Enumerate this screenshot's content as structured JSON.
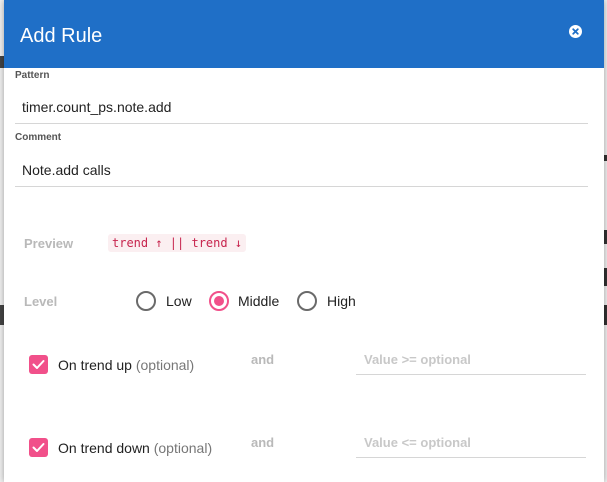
{
  "dialog": {
    "title": "Add Rule"
  },
  "pattern": {
    "label": "Pattern",
    "value": "timer.count_ps.note.add"
  },
  "comment": {
    "label": "Comment",
    "value": "Note.add calls"
  },
  "preview": {
    "label": "Preview",
    "code": "trend ↑ || trend ↓"
  },
  "level": {
    "label": "Level",
    "options": [
      {
        "label": "Low",
        "checked": false
      },
      {
        "label": "Middle",
        "checked": true
      },
      {
        "label": "High",
        "checked": false
      }
    ]
  },
  "trend_up": {
    "label": "On trend up",
    "optional": "(optional)",
    "checked": true,
    "and_label": "and",
    "value_placeholder": "Value >= optional"
  },
  "trend_down": {
    "label": "On trend down",
    "optional": "(optional)",
    "checked": true,
    "and_label": "and",
    "value_placeholder": "Value <= optional"
  },
  "colors": {
    "header": "#1f6fc7",
    "accent": "#f1508a",
    "code_text": "#c7254e"
  },
  "icons": {
    "close": "close-icon",
    "check": "check-icon"
  }
}
